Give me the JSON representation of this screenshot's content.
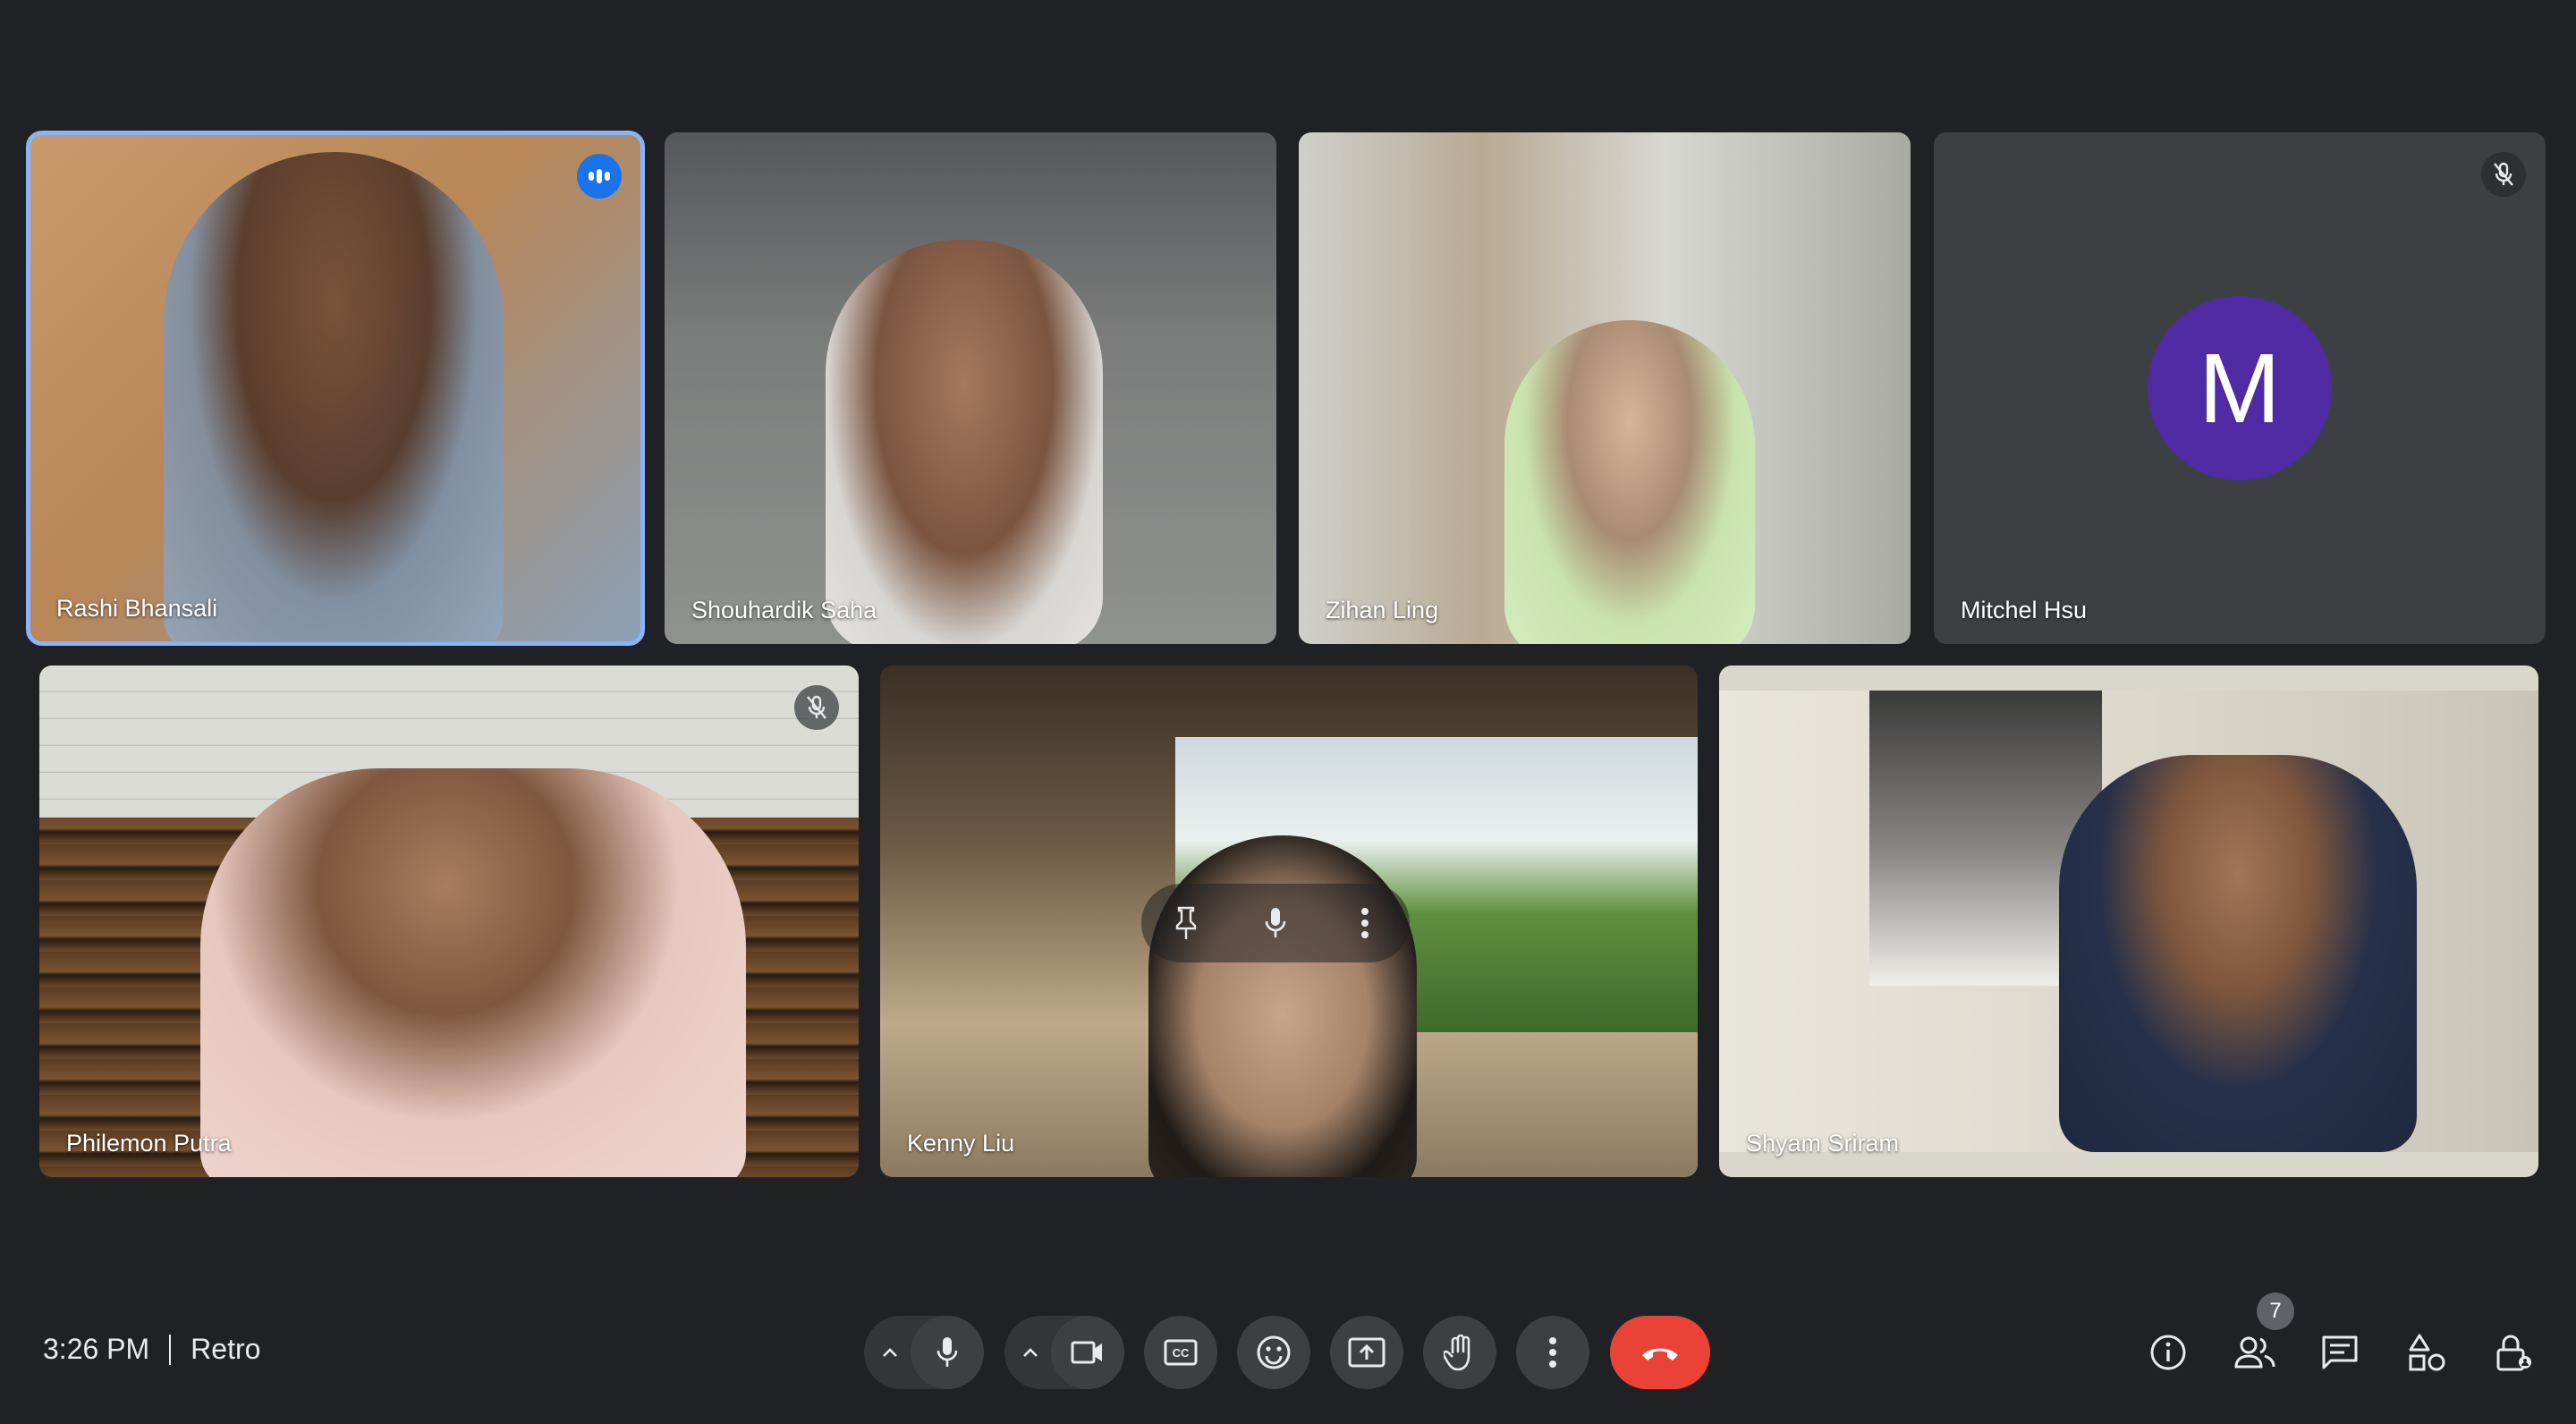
{
  "participants": [
    {
      "name": "Rashi Bhansali"
    },
    {
      "name": "Shouhardik Saha"
    },
    {
      "name": "Zihan Ling"
    },
    {
      "name": "Mitchel Hsu",
      "avatar_letter": "M"
    },
    {
      "name": "Philemon Putra"
    },
    {
      "name": "Kenny Liu"
    },
    {
      "name": "Shyam Sriram"
    }
  ],
  "footer": {
    "time": "3:26 PM",
    "meeting_name": "Retro"
  },
  "people_count": "7",
  "colors": {
    "background": "#202124",
    "tile": "#3c4043",
    "active_border": "#8ab4f8",
    "end_call": "#ea4335",
    "avatar": "#4f2aa3"
  }
}
